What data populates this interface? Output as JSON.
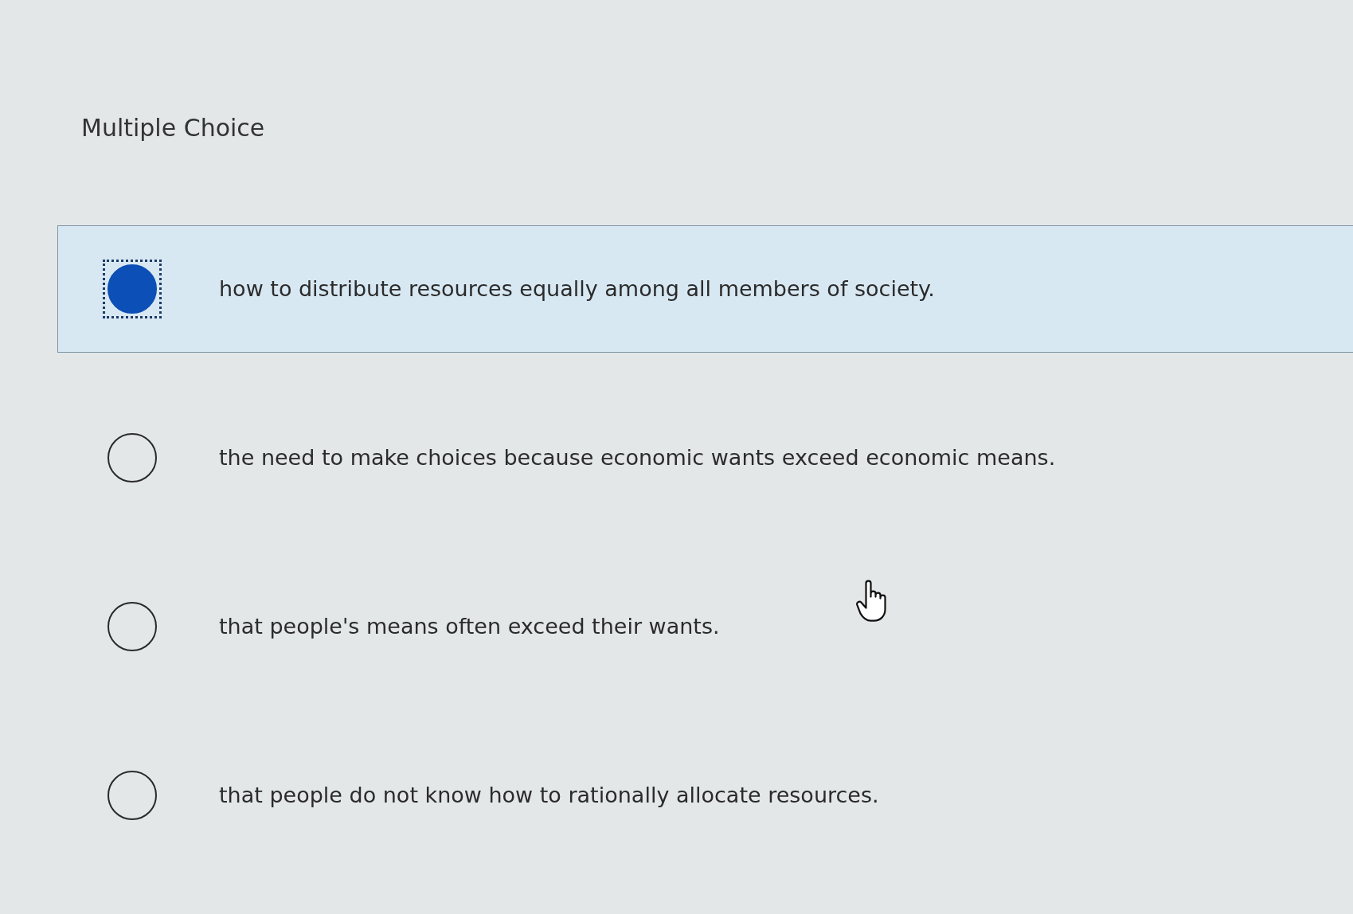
{
  "heading": "Multiple Choice",
  "options": [
    {
      "text": "how to distribute resources equally among all members of society.",
      "selected": true
    },
    {
      "text": "the need to make choices because economic wants exceed economic means.",
      "selected": false
    },
    {
      "text": "that people's means often exceed their wants.",
      "selected": false
    },
    {
      "text": "that people do not know how to rationally allocate resources.",
      "selected": false
    }
  ]
}
